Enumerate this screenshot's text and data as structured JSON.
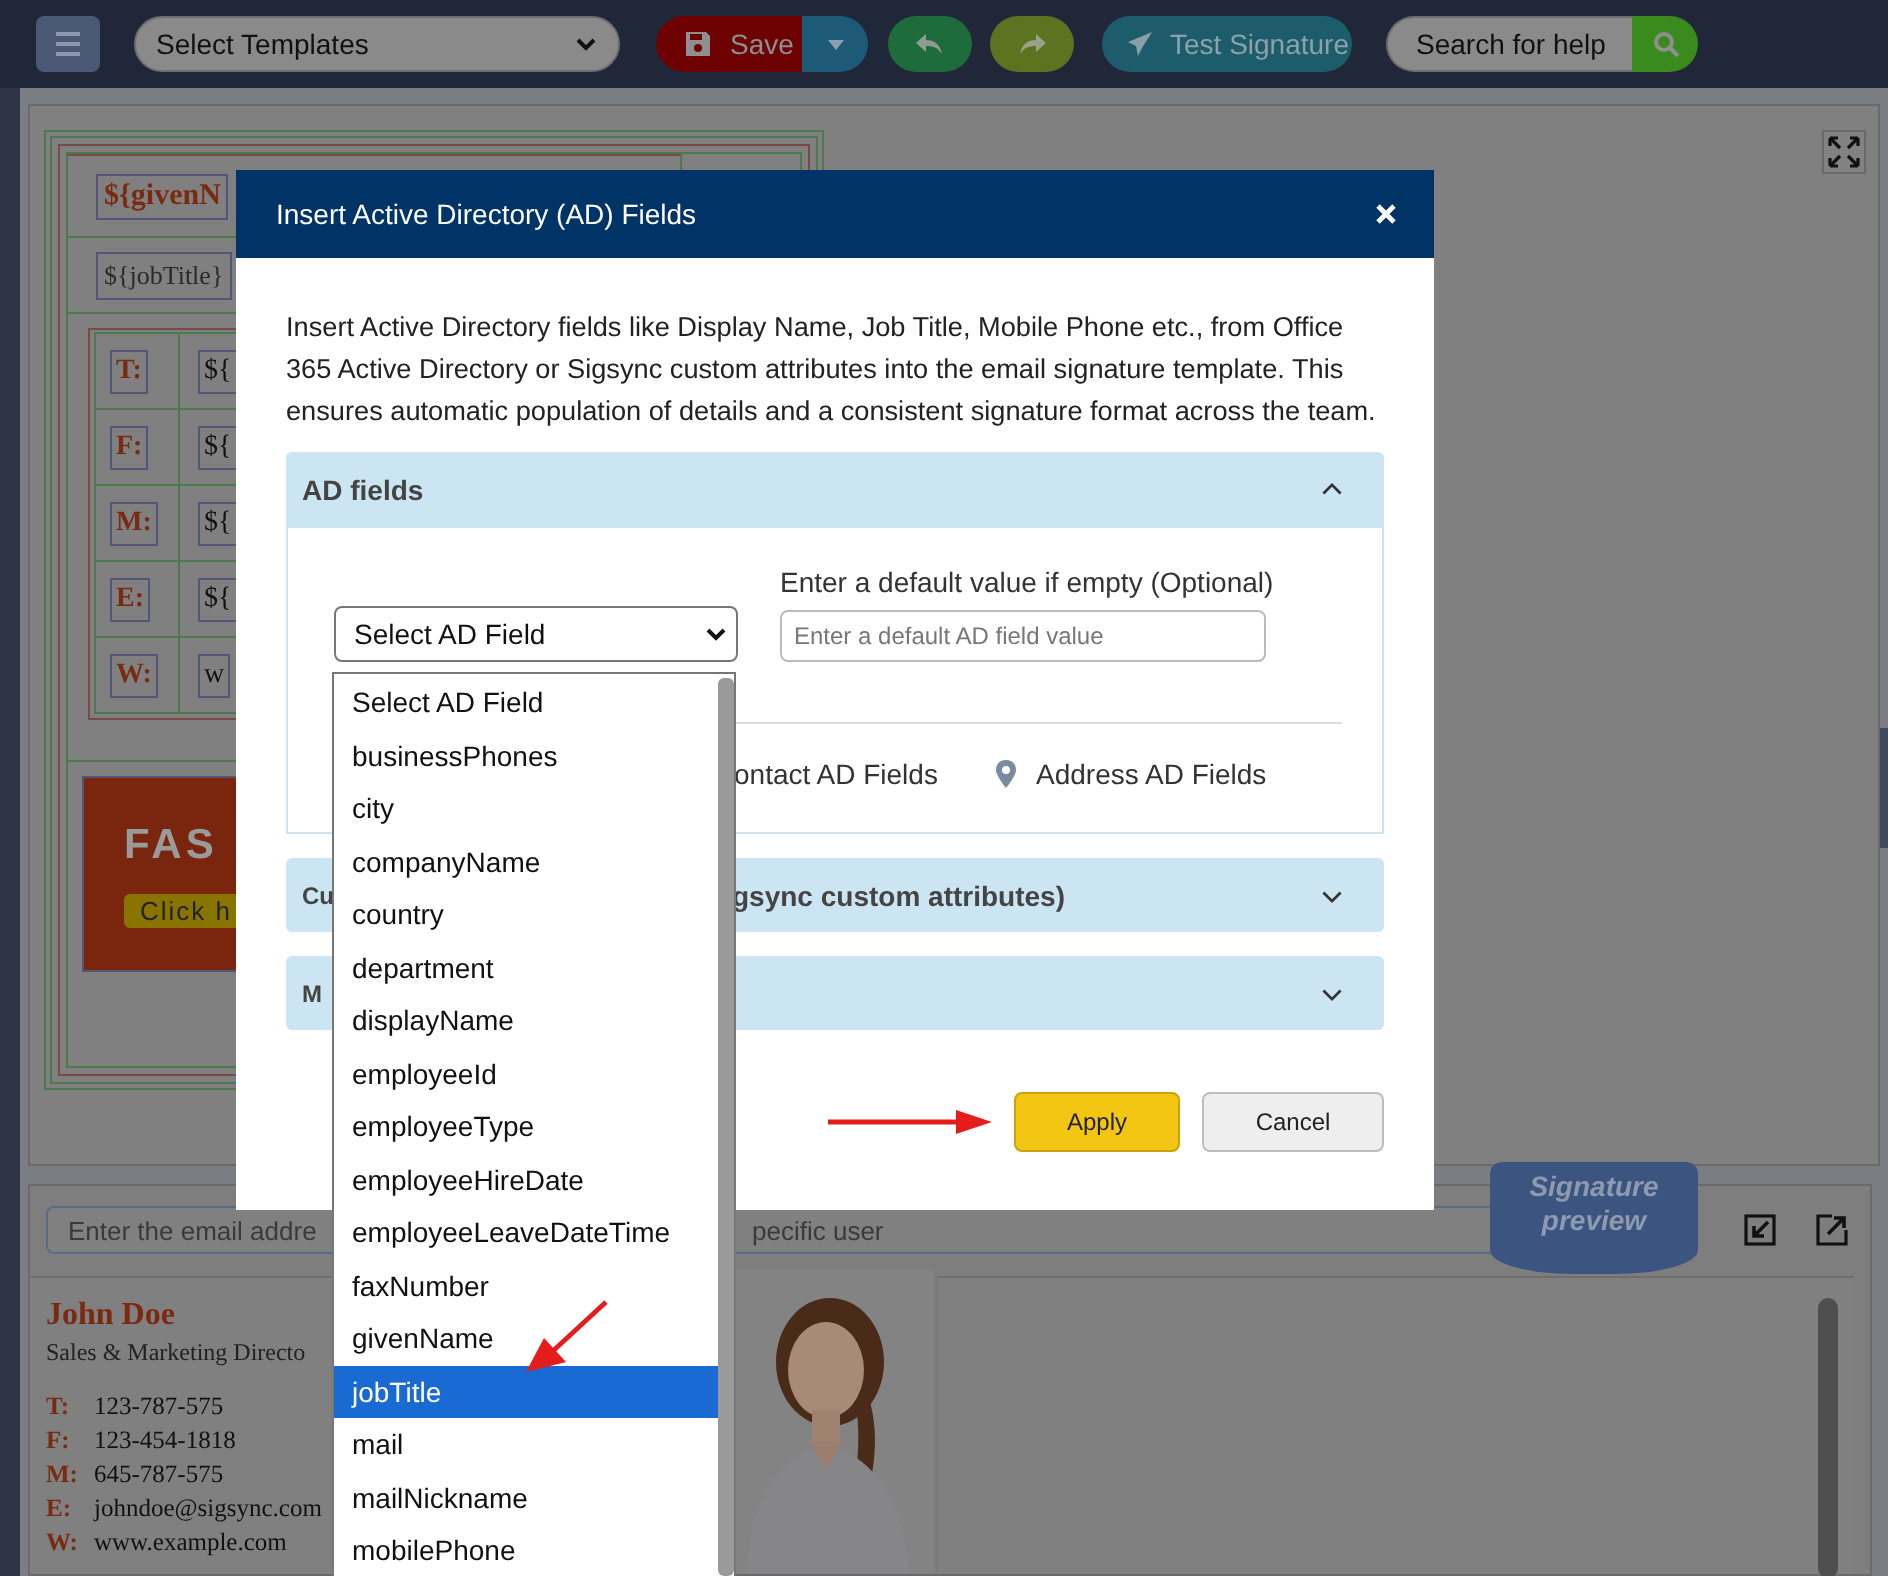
{
  "toolbar": {
    "template_select": "Select Templates",
    "save_button": "Save",
    "test_button": "Test Signature",
    "search": {
      "placeholder": "Search for help"
    }
  },
  "template": {
    "name_field": "${givenN",
    "title_field": "${jobTitle}",
    "rows": [
      {
        "label": "T:",
        "value": "${"
      },
      {
        "label": "F:",
        "value": "${"
      },
      {
        "label": "M:",
        "value": "${"
      },
      {
        "label": "E:",
        "value": "${"
      },
      {
        "label": "W:",
        "value": "w"
      }
    ],
    "banner": {
      "headline": "FAS",
      "button": "Click h"
    }
  },
  "preview": {
    "email_field": {
      "placeholder_parts": [
        "Enter the email addre",
        "pecific user"
      ]
    },
    "ribbon": "Signature preview",
    "name": "John Doe",
    "title": "Sales & Marketing Directo",
    "contacts": [
      {
        "label": "T:",
        "value": "123-787-575"
      },
      {
        "label": "F:",
        "value": "123-454-1818"
      },
      {
        "label": "M:",
        "value": "645-787-575"
      },
      {
        "label": "E:",
        "value": "johndoe@sigsync.com"
      },
      {
        "label": "W:",
        "value": "www.example.com"
      }
    ]
  },
  "dialog": {
    "title": "Insert Active Directory (AD) Fields",
    "description": "Insert Active Directory fields like Display Name, Job Title, Mobile Phone etc., from Office 365 Active Directory or Sigsync custom attributes into the email signature template. This ensures automatic population of details and a consistent signature format across the team.",
    "sections": [
      {
        "title_parts": [
          "AD fields"
        ],
        "expanded": true
      },
      {
        "title_parts": [
          "Cu",
          "gsync custom attributes)"
        ],
        "expanded": false
      },
      {
        "title_parts": [
          "M"
        ],
        "expanded": false
      }
    ],
    "ad_field_select": {
      "value": "Select AD Field"
    },
    "default_value": {
      "label": "Enter a default value if empty (Optional)",
      "placeholder": "Enter a default AD field value"
    },
    "field_groups": [
      {
        "label": "ontact AD Fields"
      },
      {
        "label": "Address AD Fields"
      }
    ],
    "buttons": [
      {
        "label": "Apply",
        "kind": "primary"
      },
      {
        "label": "Cancel",
        "kind": "secondary"
      }
    ],
    "dropdown": {
      "options": [
        {
          "label": "Select AD Field",
          "selected": false
        },
        {
          "label": "businessPhones",
          "selected": false
        },
        {
          "label": "city",
          "selected": false
        },
        {
          "label": "companyName",
          "selected": false
        },
        {
          "label": "country",
          "selected": false
        },
        {
          "label": "department",
          "selected": false
        },
        {
          "label": "displayName",
          "selected": false
        },
        {
          "label": "employeeId",
          "selected": false
        },
        {
          "label": "employeeType",
          "selected": false
        },
        {
          "label": "employeeHireDate",
          "selected": false
        },
        {
          "label": "employeeLeaveDateTime",
          "selected": false
        },
        {
          "label": "faxNumber",
          "selected": false
        },
        {
          "label": "givenName",
          "selected": false
        },
        {
          "label": "jobTitle",
          "selected": true
        },
        {
          "label": "mail",
          "selected": false
        },
        {
          "label": "mailNickname",
          "selected": false
        },
        {
          "label": "mobilePhone",
          "selected": false
        }
      ]
    }
  }
}
